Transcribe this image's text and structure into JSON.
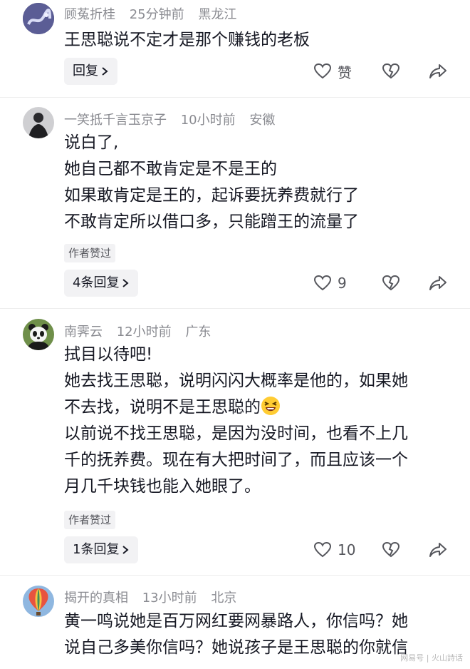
{
  "comments": [
    {
      "username": "顾菟折桂",
      "time": "25分钟前",
      "location": "黑龙江",
      "lines": [
        "王思聪说不定才是那个赚钱的老板"
      ],
      "reply_label": "回复",
      "like_label": "赞",
      "avatar_icon": "avatar-dragon-icon"
    },
    {
      "username": "一笑抵千言玉京子",
      "time": "10小时前",
      "location": "安徽",
      "lines": [
        "说白了,",
        "她自己都不敢肯定是不是王的",
        "如果敢肯定是王的，起诉要抚养费就行了",
        "不敢肯定所以借口多，只能蹭王的流量了"
      ],
      "badge": "作者赞过",
      "reply_label": "4条回复",
      "like_count": "9",
      "avatar_icon": "avatar-figure-icon"
    },
    {
      "username": "南霁云",
      "time": "12小时前",
      "location": "广东",
      "lines": [
        "拭目以待吧!",
        "她去找王思聪，说明闪闪大概率是他的，如果她",
        "不去找，说明不是王思聪的",
        "以前说不找王思聪，是因为没时间，也看不上几",
        "千的抚养费。现在有大把时间了，而且应该一个",
        "月几千块钱也能入她眼了。"
      ],
      "badge": "作者赞过",
      "reply_label": "1条回复",
      "like_count": "10",
      "avatar_icon": "avatar-panda-icon"
    },
    {
      "username": "揭开的真相",
      "time": "13小时前",
      "location": "北京",
      "lines": [
        "黄一鸣说她是百万网红要网暴路人，你信吗？她",
        "说自己多美你信吗？她说孩子是王思聪的你就信"
      ],
      "avatar_icon": "avatar-balloon-icon"
    }
  ],
  "watermark": "网易号 | 火山詩话",
  "colors": {
    "text": "#161823",
    "meta": "#8a8b91",
    "button_bg": "#f2f2f4",
    "divider": "#ededed"
  }
}
